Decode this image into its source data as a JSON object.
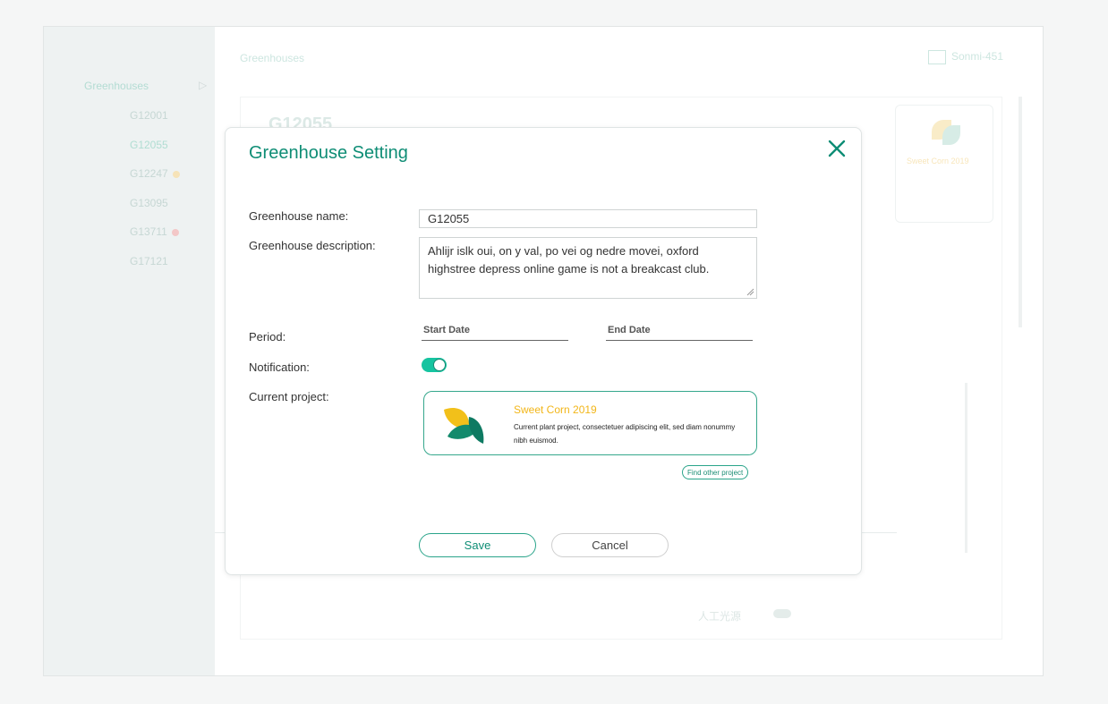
{
  "sidebar": {
    "heading": "Greenhouses",
    "items": [
      {
        "label": "G12001",
        "status": "none"
      },
      {
        "label": "G12055",
        "status": "active"
      },
      {
        "label": "G12247",
        "status": "warning"
      },
      {
        "label": "G13095",
        "status": "none"
      },
      {
        "label": "G13711",
        "status": "error"
      },
      {
        "label": "G17121",
        "status": "none"
      }
    ]
  },
  "header": {
    "breadcrumb": "Greenhouses",
    "user": "Sonmi-451"
  },
  "background": {
    "greenhouse_title": "G12055",
    "card_title": "Sweet Corn 2019",
    "zh_label": "人工光源"
  },
  "modal": {
    "title": "Greenhouse Setting",
    "fields": {
      "name_label": "Greenhouse name:",
      "name_value": "G12055",
      "description_label": "Greenhouse description:",
      "description_value": "Ahlijr islk oui, on y val, po vei og nedre movei, oxford highstree depress online game is not a breakcast club.",
      "period_label": "Period:",
      "start_date_placeholder": "Start Date",
      "end_date_placeholder": "End Date",
      "notification_label": "Notification:",
      "notification_on": true,
      "current_project_label": "Current project:"
    },
    "project": {
      "title": "Sweet Corn 2019",
      "description": "Current plant project, consectetuer adipiscing elit, sed diam nonummy nibh euismod.",
      "icon": "corn-leaves-logo"
    },
    "find_other_label": "Find other project",
    "save_label": "Save",
    "cancel_label": "Cancel"
  },
  "colors": {
    "accent": "#0e8d75",
    "toggle_on": "#16c4a0",
    "project_title": "#f2b619",
    "leaf_yellow": "#f2c01a",
    "leaf_green": "#128a6c"
  }
}
